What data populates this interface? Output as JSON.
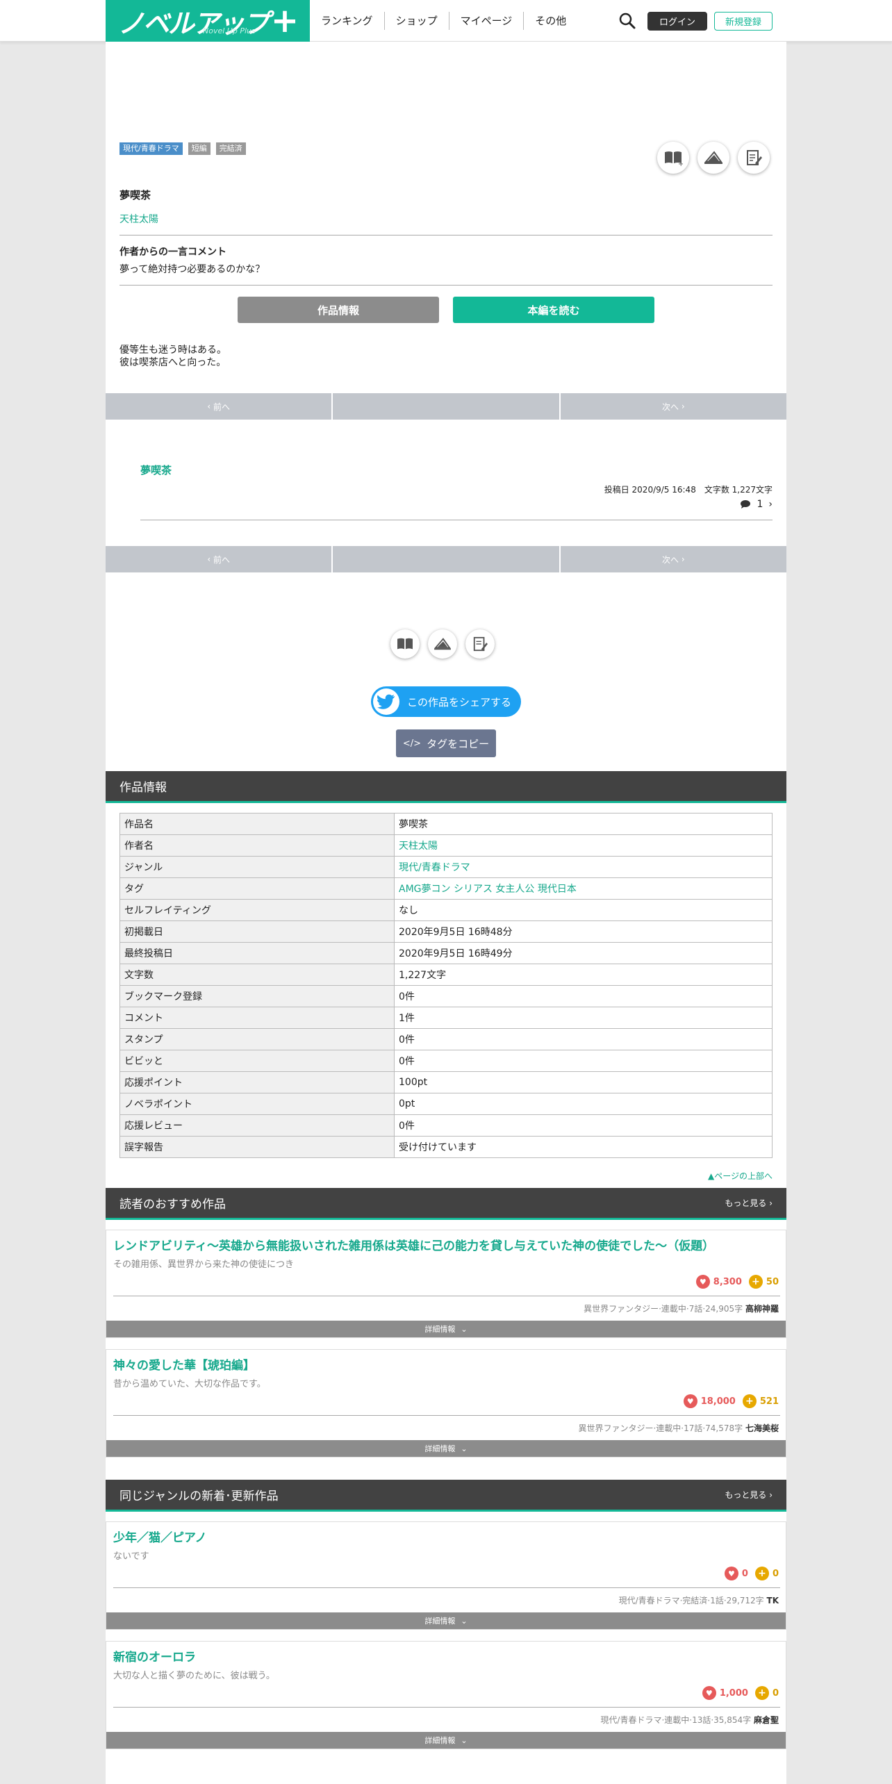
{
  "header": {
    "logo_text": "ノベルアップ",
    "logo_plus": "+",
    "logo_sub": "Novel Up Plus",
    "nav": [
      "ランキング",
      "ショップ",
      "マイページ",
      "その他"
    ],
    "login": "ログイン",
    "register": "新規登録"
  },
  "work": {
    "tags": [
      "現代/青春ドラマ",
      "短編",
      "完結済"
    ],
    "title": "夢喫茶",
    "author": "天柱太陽",
    "comment_heading": "作者からの一言コメント",
    "comment": "夢って絶対持つ必要あるのかな？",
    "btn_info": "作品情報",
    "btn_read": "本編を読む",
    "summary_1": "優等生も迷う時はある。",
    "summary_2": "彼は喫茶店へと向った。"
  },
  "pager": {
    "prev": "前へ",
    "next": "次へ"
  },
  "episode": {
    "title": "夢喫茶",
    "meta": "投稿日 2020/9/5 16:48　文字数 1,227文字",
    "comments": "1"
  },
  "share": {
    "twitter": "この作品をシェアする",
    "copy": "タグをコピー"
  },
  "info_section": {
    "heading": "作品情報",
    "rows": [
      {
        "k": "作品名",
        "v": "夢喫茶",
        "link": false
      },
      {
        "k": "作者名",
        "v": "天柱太陽",
        "link": true
      },
      {
        "k": "ジャンル",
        "v": "現代/青春ドラマ",
        "link": true
      },
      {
        "k": "タグ",
        "v": "AMG夢コン シリアス 女主人公 現代日本",
        "link": true
      },
      {
        "k": "セルフレイティング",
        "v": "なし",
        "link": false
      },
      {
        "k": "初掲載日",
        "v": "2020年9月5日 16時48分",
        "link": false
      },
      {
        "k": "最終投稿日",
        "v": "2020年9月5日 16時49分",
        "link": false
      },
      {
        "k": "文字数",
        "v": "1,227文字",
        "link": false
      },
      {
        "k": "ブックマーク登録",
        "v": "0件",
        "link": false
      },
      {
        "k": "コメント",
        "v": "1件",
        "link": false
      },
      {
        "k": "スタンプ",
        "v": "0件",
        "link": false
      },
      {
        "k": "ビビッと",
        "v": "0件",
        "link": false
      },
      {
        "k": "応援ポイント",
        "v": "100pt",
        "link": false
      },
      {
        "k": "ノベラポイント",
        "v": "0pt",
        "link": false
      },
      {
        "k": "応援レビュー",
        "v": "0件",
        "link": false
      },
      {
        "k": "誤字報告",
        "v": "受け付けています",
        "link": false
      }
    ],
    "top_link": "▲ページの上部へ"
  },
  "recommend": {
    "heading": "読者のおすすめ作品",
    "more": "もっと見る",
    "cards": [
      {
        "title": "レンドアビリティ～英雄から無能扱いされた雑用係は英雄に己の能力を貸し与えていた神の使徒でした～（仮題）",
        "desc": "その雑用係、異世界から来た神の使徒につき",
        "hearts": "8,300",
        "coins": "50",
        "meta": "異世界ファンタジー·連載中·7話·24,905字",
        "author": "高柳神羅",
        "detail": "詳細情報"
      },
      {
        "title": "神々の愛した華【琥珀編】",
        "desc": "昔から温めていた、大切な作品です。",
        "hearts": "18,000",
        "coins": "521",
        "meta": "異世界ファンタジー·連載中·17話·74,578字",
        "author": "七海美桜",
        "detail": "詳細情報"
      }
    ]
  },
  "same_genre": {
    "heading": "同じジャンルの新着･更新作品",
    "more": "もっと見る",
    "cards": [
      {
        "title": "少年／猫／ピアノ",
        "desc": "ないです",
        "hearts": "0",
        "coins": "0",
        "meta": "現代/青春ドラマ·完結済·1話·29,712字",
        "author": "TK",
        "detail": "詳細情報"
      },
      {
        "title": "新宿のオーロラ",
        "desc": "大切な人と描く夢のために、彼は戦う。",
        "hearts": "1,000",
        "coins": "0",
        "meta": "現代/青春ドラマ·連載中·13話·35,854字",
        "author": "麻倉聖",
        "detail": "詳細情報"
      }
    ]
  }
}
